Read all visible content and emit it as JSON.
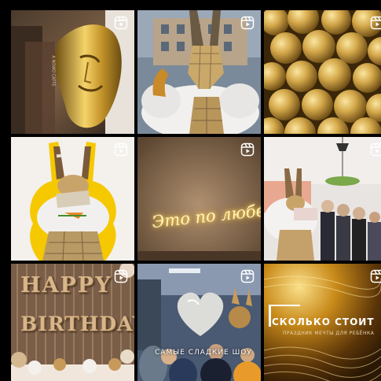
{
  "grid": {
    "tiles": [
      {
        "name": "gold-mask-post",
        "icon": "reels-icon",
        "caption": "A NOWO CAFFE"
      },
      {
        "name": "mirror-bunny-post",
        "icon": "reels-icon"
      },
      {
        "name": "gold-chocolates-post",
        "icon": "reels-icon"
      },
      {
        "name": "bunny-costume-post",
        "icon": "reels-icon"
      },
      {
        "name": "neon-sign-post",
        "icon": "reels-icon",
        "neon_text": "Это по любви"
      },
      {
        "name": "kids-party-post",
        "icon": "reels-icon"
      },
      {
        "name": "happy-birthday-post",
        "icon": "reels-icon",
        "line1": "HAPPY",
        "line2": "BIRTHDAY",
        "sign_text": "САМЫЕ СЛАДКИЕ ШОУ"
      },
      {
        "name": "heart-balloon-post",
        "icon": "reels-icon"
      },
      {
        "name": "price-post",
        "icon": "reels-icon",
        "title": "СКОЛЬКО СТОИТ",
        "subtitle": "ПРАЗДНИК МЕЧТЫ ДЛЯ РЕБЁНКА"
      }
    ]
  },
  "colors": {
    "background": "#000000",
    "gold": "#d4a84a",
    "neon": "#fff3b8"
  }
}
